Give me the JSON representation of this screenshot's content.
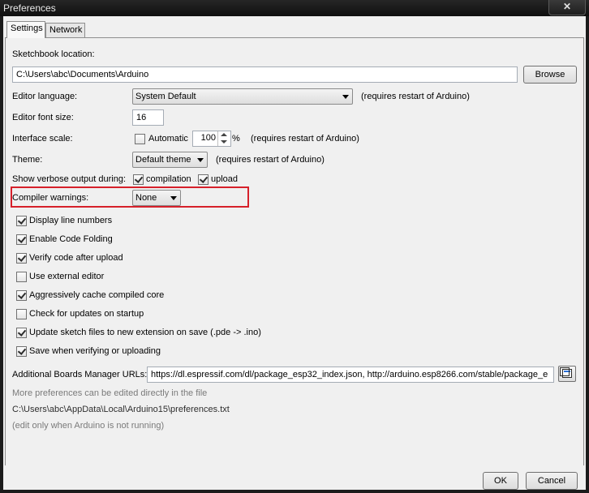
{
  "window": {
    "title": "Preferences",
    "close_label": "✕"
  },
  "tabs": [
    {
      "label": "Settings"
    },
    {
      "label": "Network"
    }
  ],
  "sketchbook": {
    "label": "Sketchbook location:",
    "value": "C:\\Users\\abc\\Documents\\Arduino",
    "browse_label": "Browse"
  },
  "editor_language": {
    "label": "Editor language:",
    "value": "System Default",
    "note": "(requires restart of Arduino)"
  },
  "font_size": {
    "label": "Editor font size:",
    "value": "16"
  },
  "interface_scale": {
    "label": "Interface scale:",
    "automatic_label": "Automatic",
    "automatic_checked": false,
    "value": "100",
    "unit": "%",
    "note": "(requires restart of Arduino)"
  },
  "theme": {
    "label": "Theme:",
    "value": "Default theme",
    "note": "(requires restart of Arduino)"
  },
  "verbose": {
    "label": "Show verbose output during:",
    "compilation_label": "compilation",
    "compilation_checked": true,
    "upload_label": "upload",
    "upload_checked": true
  },
  "compiler_warnings": {
    "label": "Compiler warnings:",
    "value": "None"
  },
  "options": [
    {
      "label": "Display line numbers",
      "checked": true
    },
    {
      "label": "Enable Code Folding",
      "checked": true
    },
    {
      "label": "Verify code after upload",
      "checked": true
    },
    {
      "label": "Use external editor",
      "checked": false
    },
    {
      "label": "Aggressively cache compiled core",
      "checked": true
    },
    {
      "label": "Check for updates on startup",
      "checked": false
    },
    {
      "label": "Update sketch files to new extension on save (.pde -> .ino)",
      "checked": true
    },
    {
      "label": "Save when verifying or uploading",
      "checked": true
    }
  ],
  "boards_urls": {
    "label": "Additional Boards Manager URLs:",
    "value": "https://dl.espressif.com/dl/package_esp32_index.json, http://arduino.esp8266.com/stable/package_e"
  },
  "info": {
    "line1": "More preferences can be edited directly in the file",
    "path": "C:\\Users\\abc\\AppData\\Local\\Arduino15\\preferences.txt",
    "line3": "(edit only when Arduino is not running)"
  },
  "footer": {
    "ok_label": "OK",
    "cancel_label": "Cancel"
  },
  "colors": {
    "highlight": "#d6202a",
    "background": "#f0f0f0"
  }
}
